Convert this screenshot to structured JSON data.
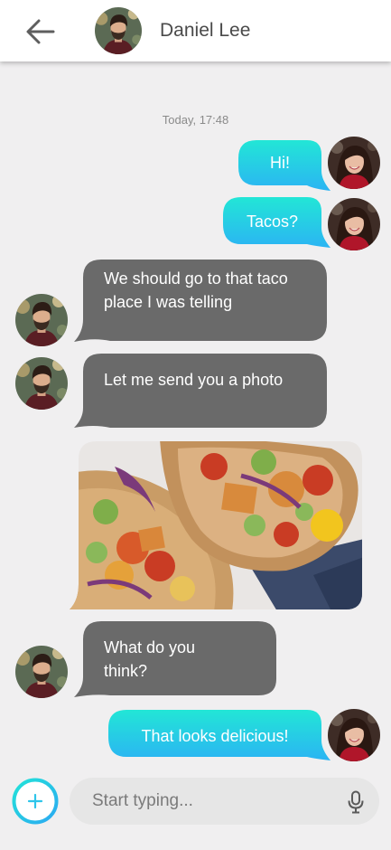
{
  "header": {
    "contact_name": "Daniel Lee"
  },
  "chat": {
    "timestamp": "Today, 17:48",
    "messages": [
      {
        "from": "me",
        "text": "Hi!"
      },
      {
        "from": "me",
        "text": "Tacos?"
      },
      {
        "from": "contact",
        "text": "We should go to that taco place I was telling"
      },
      {
        "from": "contact",
        "text": "Let me send you a photo"
      },
      {
        "from": "contact",
        "type": "photo",
        "subject": "tacos"
      },
      {
        "from": "contact",
        "text": "What do you think?"
      },
      {
        "from": "me",
        "text": "That looks delicious!"
      }
    ]
  },
  "composer": {
    "placeholder": "Start typing..."
  },
  "colors": {
    "outgoing_gradient_start": "#22e3d8",
    "outgoing_gradient_end": "#2bb6f2",
    "incoming_bubble": "#6a6a6a",
    "accent": "#2ec5ea",
    "background": "#f0eff0"
  },
  "icons": [
    "back-arrow-icon",
    "plus-icon",
    "microphone-icon"
  ]
}
